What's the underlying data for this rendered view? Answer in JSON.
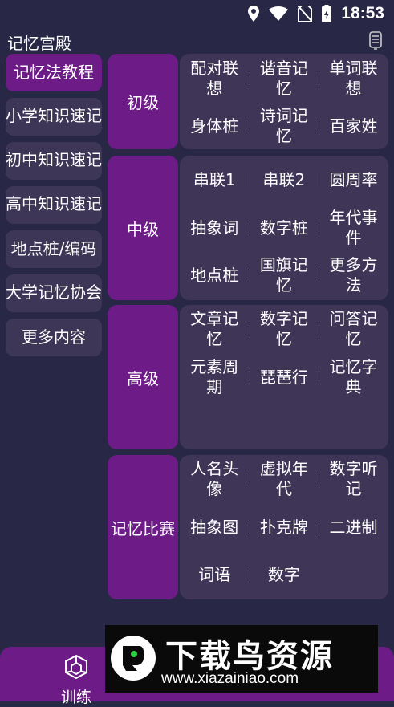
{
  "status_bar": {
    "time": "18:53"
  },
  "app_title": "记忆宫殿",
  "sidebar": {
    "items": [
      {
        "label": "记忆法教程"
      },
      {
        "label": "小学知识速记"
      },
      {
        "label": "初中知识速记"
      },
      {
        "label": "高中知识速记"
      },
      {
        "label": "地点桩/编码"
      },
      {
        "label": "大学记忆协会"
      },
      {
        "label": "更多内容"
      }
    ]
  },
  "levels": {
    "beginner": {
      "label": "初级",
      "rows": [
        [
          "配对联\n想",
          "谐音记\n忆",
          "单词联\n想"
        ],
        [
          "身体桩",
          "诗词记\n忆",
          "百家姓"
        ]
      ]
    },
    "intermediate": {
      "label": "中级",
      "rows": [
        [
          "串联1",
          "串联2",
          "圆周率"
        ],
        [
          "抽象词",
          "数字桩",
          "年代事\n件"
        ],
        [
          "地点桩",
          "国旗记\n忆",
          "更多方\n法"
        ]
      ]
    },
    "advanced": {
      "label": "高级",
      "rows": [
        [
          "文章记\n忆",
          "数字记\n忆",
          "问答记\n忆"
        ],
        [
          "元素周\n期",
          "琵琶行",
          "记忆字\n典"
        ]
      ]
    },
    "competition": {
      "label": "记忆比赛",
      "rows": [
        [
          "人名头\n像",
          "虚拟年\n代",
          "数字听\n记"
        ],
        [
          "抽象图",
          "扑克牌",
          "二进制"
        ],
        [
          "词语",
          "数字"
        ]
      ]
    }
  },
  "bottom_nav": {
    "train_label": "训练"
  },
  "watermark": {
    "title": "下载鸟资源",
    "url": "www.xiazainiao.com"
  },
  "colors": {
    "background": "#282746",
    "accent": "#6d1b87",
    "panel": "#3f3557"
  }
}
